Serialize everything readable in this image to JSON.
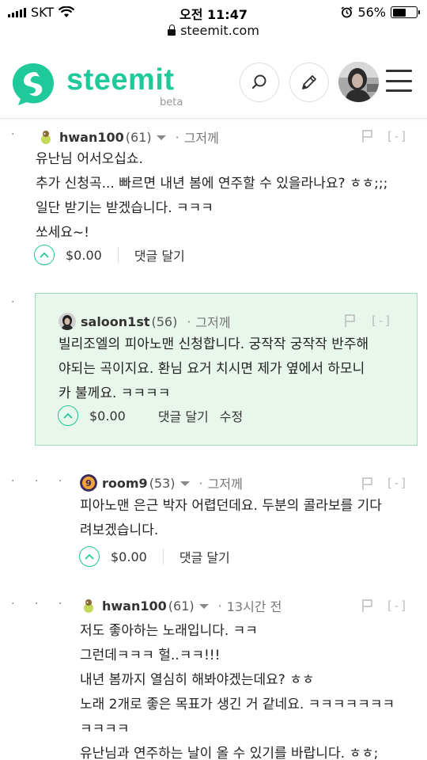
{
  "status_bar": {
    "carrier": "SKT",
    "time": "오전 11:47",
    "battery_percent": "56%",
    "battery_level": 0.56
  },
  "browser": {
    "url": "steemit.com"
  },
  "header": {
    "logo_text": "steemit",
    "beta_label": "beta",
    "brand_color": "#1fc99a"
  },
  "comments": [
    {
      "username": "hwan100",
      "reputation": "(61)",
      "time": "그저께",
      "lines": [
        "유난님 어서오십쇼.",
        "추가 신청곡... 빠르면 내년 봄에 연주할 수 있을라나요? ㅎㅎ;;;",
        "일단 받기는 받겠습니다. ㅋㅋㅋ",
        "쏘세요~!"
      ],
      "payout": "$0.00",
      "reply_label": "댓글 달기",
      "collapse_label": "[-]"
    },
    {
      "username": "saloon1st",
      "reputation": "(56)",
      "time": "그저께",
      "lines": [
        "빌리조엘의 피아노맨 신청합니다. 궁작작 궁작작 반주해",
        "야되는 곡이지요. 환님 요거 치시면 제가 옆에서 하모니",
        "카 불께요. ㅋㅋㅋㅋ"
      ],
      "payout": "$0.00",
      "reply_label": "댓글 달기",
      "edit_label": "수정",
      "collapse_label": "[-]",
      "highlight_color": "#e9f6ec"
    },
    {
      "username": "room9",
      "reputation": "(53)",
      "time": "그저께",
      "lines": [
        "피아노맨 은근 박자 어렵던데요. 두분의 콜라보를 기다",
        "려보겠습니다."
      ],
      "payout": "$0.00",
      "reply_label": "댓글 달기",
      "collapse_label": "[-]"
    },
    {
      "username": "hwan100",
      "reputation": "(61)",
      "time": "13시간 전",
      "lines": [
        "저도 좋아하는 노래입니다. ㅋㅋ",
        "그런데ㅋㅋㅋ 헐..ㅋㅋ!!!",
        "내년 봄까지 열심히 해봐야겠는데요? ㅎㅎ",
        "노래 2개로 좋은 목표가 생긴 거 같네요. ㅋㅋㅋㅋㅋㅋㅋ",
        "ㅋㅋㅋㅋ",
        "유난님과 연주하는 날이 올 수 있기를 바랍니다. ㅎㅎ;"
      ],
      "collapse_label": "[-]"
    }
  ]
}
